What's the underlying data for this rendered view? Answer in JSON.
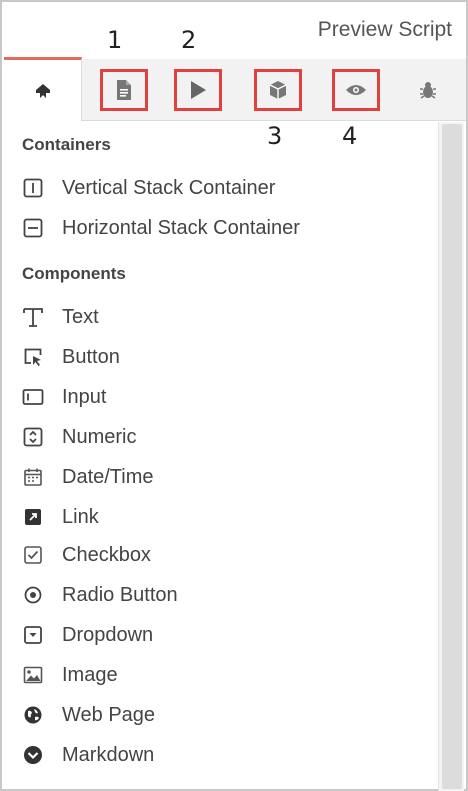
{
  "header": {
    "preview_label": "Preview Script"
  },
  "tabs": [
    {
      "icon": "palette-pin-icon",
      "active": true
    },
    {
      "icon": "document-icon",
      "callout": "1"
    },
    {
      "icon": "play-icon",
      "callout": "2"
    },
    {
      "icon": "cube-icon",
      "callout": "3"
    },
    {
      "icon": "eye-icon",
      "callout": "4"
    },
    {
      "icon": "bug-icon"
    }
  ],
  "containers": {
    "title": "Containers",
    "items": [
      {
        "label": "Vertical Stack Container",
        "icon": "vertical-stack-icon"
      },
      {
        "label": "Horizontal Stack Container",
        "icon": "horizontal-stack-icon"
      }
    ]
  },
  "components": {
    "title": "Components",
    "items": [
      {
        "label": "Text",
        "icon": "text-icon"
      },
      {
        "label": "Button",
        "icon": "button-cursor-icon"
      },
      {
        "label": "Input",
        "icon": "input-icon"
      },
      {
        "label": "Numeric",
        "icon": "numeric-icon"
      },
      {
        "label": "Date/Time",
        "icon": "calendar-icon"
      },
      {
        "label": "Link",
        "icon": "link-icon"
      },
      {
        "label": "Checkbox",
        "icon": "checkbox-icon"
      },
      {
        "label": "Radio Button",
        "icon": "radio-icon"
      },
      {
        "label": "Dropdown",
        "icon": "dropdown-icon"
      },
      {
        "label": "Image",
        "icon": "image-icon"
      },
      {
        "label": "Web Page",
        "icon": "globe-icon"
      },
      {
        "label": "Markdown",
        "icon": "markdown-icon"
      }
    ]
  },
  "colors": {
    "highlight": "#e0413c",
    "active_tab_accent": "#e46a5a"
  }
}
